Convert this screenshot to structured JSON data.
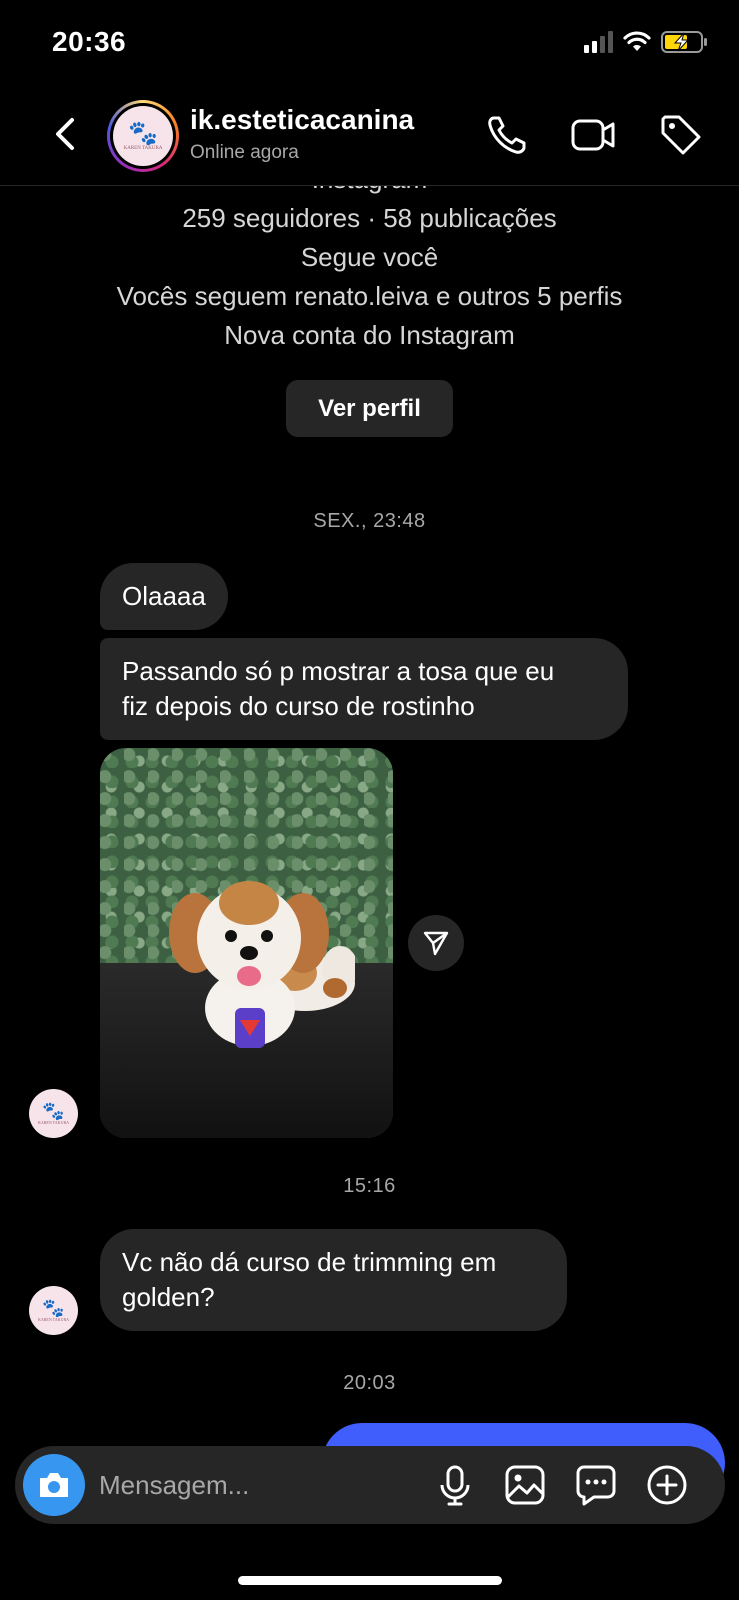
{
  "status_bar": {
    "time": "20:36"
  },
  "header": {
    "username": "ik.esteticacanina",
    "status": "Online agora",
    "avatar_brand": "KAREN TAKURA"
  },
  "profile": {
    "cut_line": "Instagram",
    "stats": "259 seguidores · 58 publicações",
    "follows_you": "Segue você",
    "mutual": "Vocês seguem renato.leiva e outros 5 perfis",
    "new_account": "Nova conta do Instagram",
    "view_profile_label": "Ver perfil"
  },
  "messages": {
    "timestamp_1": "SEX., 23:48",
    "msg_1": "Olaaaa",
    "msg_2_line1": "Passando só p mostrar a tosa que eu",
    "msg_2_line2": "fiz depois do curso de rostinho",
    "timestamp_2": "15:16",
    "msg_3_line1": "Vc não dá curso de trimming em",
    "msg_3_line2": "golden?",
    "timestamp_3": "20:03"
  },
  "composer": {
    "placeholder": "Mensagem..."
  },
  "colors": {
    "background": "#000000",
    "bubble_received": "#262626",
    "bubble_sent": "#3f5efb",
    "camera_button": "#3797f0",
    "battery_charging": "#ffd60a"
  },
  "icons": [
    "chevron-left-icon",
    "phone-icon",
    "video-icon",
    "tag-icon",
    "send-icon",
    "camera-icon",
    "microphone-icon",
    "gallery-icon",
    "sticker-icon",
    "plus-icon"
  ]
}
